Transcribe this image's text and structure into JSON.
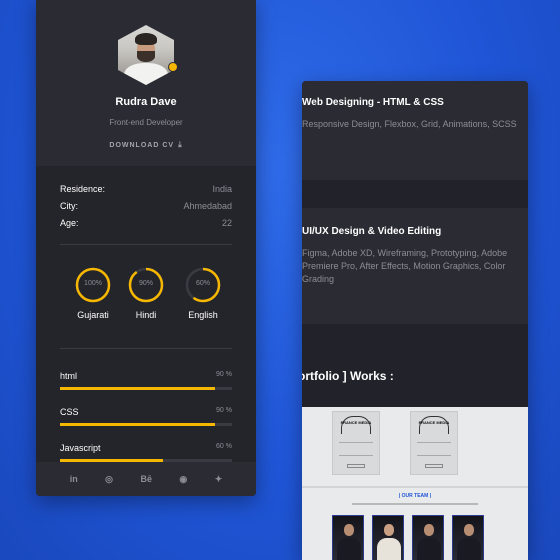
{
  "profile": {
    "name": "Rudra Dave",
    "role": "Front-end Developer",
    "download_label": "DOWNLOAD CV",
    "info": [
      {
        "key": "Residence:",
        "value": "India"
      },
      {
        "key": "City:",
        "value": "Ahmedabad"
      },
      {
        "key": "Age:",
        "value": "22"
      }
    ],
    "languages": [
      {
        "label": "Gujarati",
        "percent_label": "100%",
        "level": 1.0
      },
      {
        "label": "Hindi",
        "percent_label": "90%",
        "level": 0.9
      },
      {
        "label": "English",
        "percent_label": "60%",
        "level": 0.6
      }
    ],
    "skills": [
      {
        "label": "html",
        "percent_label": "90 %",
        "level": 0.9
      },
      {
        "label": "CSS",
        "percent_label": "90 %",
        "level": 0.9
      },
      {
        "label": "Javascript",
        "percent_label": "60 %",
        "level": 0.6
      }
    ],
    "social": [
      {
        "icon": "linkedin-icon",
        "glyph": "in"
      },
      {
        "icon": "dribbble-icon",
        "glyph": "◎"
      },
      {
        "icon": "behance-icon",
        "glyph": "Bē"
      },
      {
        "icon": "github-icon",
        "glyph": "◉"
      },
      {
        "icon": "twitter-icon",
        "glyph": "✦"
      }
    ]
  },
  "services": [
    {
      "title": "Web Designing - HTML & CSS",
      "description": "Responsive Design, Flexbox, Grid, Animations, SCSS"
    },
    {
      "title": "UI/UX Design & Video Editing",
      "description": "Figma, Adobe XD, Wireframing, Prototyping, Adobe Premiere Pro, After Effects, Motion Graphics, Color Grading"
    }
  ],
  "works": {
    "title": "ortfolio ] Works :",
    "poster_text": "FRANCE MEDIA",
    "team_label": "| OUR TEAM |"
  },
  "colors": {
    "accent": "#f5b700",
    "card_bg": "#24242b",
    "background": "#1f55d6"
  }
}
